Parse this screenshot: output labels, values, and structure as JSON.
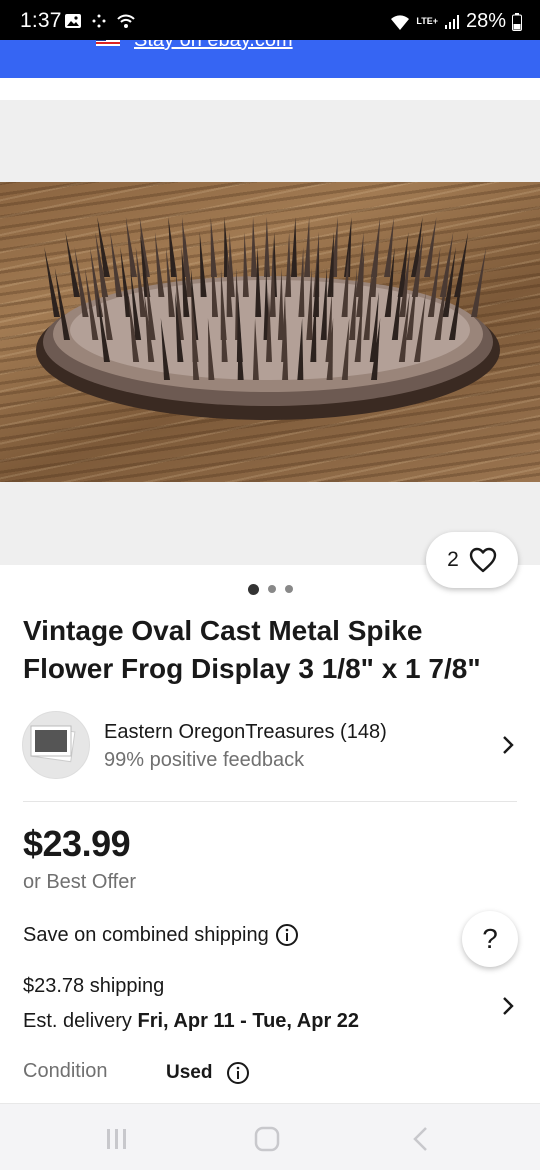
{
  "status_bar": {
    "time": "1:37",
    "network": "LTE+",
    "battery": "28%"
  },
  "banner": {
    "link_text": "Stay on ebay.com"
  },
  "gallery": {
    "image_description_icon": "photo",
    "watch_count": "2",
    "page_dots": 3,
    "active_dot": 0
  },
  "listing": {
    "title": "Vintage Oval Cast Metal Spike Flower Frog Display 3 1/8\" x 1 7/8\""
  },
  "seller": {
    "name": "Eastern OregonTreasures (148)",
    "feedback": "99% positive feedback"
  },
  "pricing": {
    "price": "$23.99",
    "best_offer": "or Best Offer",
    "combined_shipping": "Save on combined shipping",
    "help_label": "?"
  },
  "shipping": {
    "cost": "$23.78 shipping",
    "est_label": "Est. delivery",
    "est_dates": "Fri, Apr 11 - Tue, Apr 22"
  },
  "condition": {
    "label": "Condition",
    "value": "Used"
  },
  "colors": {
    "accent": "#3665f3",
    "text": "#191919",
    "muted": "#707070"
  }
}
